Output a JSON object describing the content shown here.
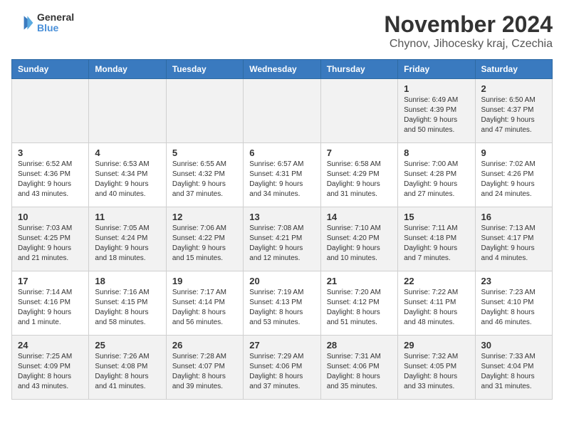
{
  "header": {
    "logo": {
      "line1": "General",
      "line2": "Blue"
    },
    "title": "November 2024",
    "subtitle": "Chynov, Jihocesky kraj, Czechia"
  },
  "weekdays": [
    "Sunday",
    "Monday",
    "Tuesday",
    "Wednesday",
    "Thursday",
    "Friday",
    "Saturday"
  ],
  "weeks": [
    [
      {
        "day": "",
        "info": ""
      },
      {
        "day": "",
        "info": ""
      },
      {
        "day": "",
        "info": ""
      },
      {
        "day": "",
        "info": ""
      },
      {
        "day": "",
        "info": ""
      },
      {
        "day": "1",
        "info": "Sunrise: 6:49 AM\nSunset: 4:39 PM\nDaylight: 9 hours\nand 50 minutes."
      },
      {
        "day": "2",
        "info": "Sunrise: 6:50 AM\nSunset: 4:37 PM\nDaylight: 9 hours\nand 47 minutes."
      }
    ],
    [
      {
        "day": "3",
        "info": "Sunrise: 6:52 AM\nSunset: 4:36 PM\nDaylight: 9 hours\nand 43 minutes."
      },
      {
        "day": "4",
        "info": "Sunrise: 6:53 AM\nSunset: 4:34 PM\nDaylight: 9 hours\nand 40 minutes."
      },
      {
        "day": "5",
        "info": "Sunrise: 6:55 AM\nSunset: 4:32 PM\nDaylight: 9 hours\nand 37 minutes."
      },
      {
        "day": "6",
        "info": "Sunrise: 6:57 AM\nSunset: 4:31 PM\nDaylight: 9 hours\nand 34 minutes."
      },
      {
        "day": "7",
        "info": "Sunrise: 6:58 AM\nSunset: 4:29 PM\nDaylight: 9 hours\nand 31 minutes."
      },
      {
        "day": "8",
        "info": "Sunrise: 7:00 AM\nSunset: 4:28 PM\nDaylight: 9 hours\nand 27 minutes."
      },
      {
        "day": "9",
        "info": "Sunrise: 7:02 AM\nSunset: 4:26 PM\nDaylight: 9 hours\nand 24 minutes."
      }
    ],
    [
      {
        "day": "10",
        "info": "Sunrise: 7:03 AM\nSunset: 4:25 PM\nDaylight: 9 hours\nand 21 minutes."
      },
      {
        "day": "11",
        "info": "Sunrise: 7:05 AM\nSunset: 4:24 PM\nDaylight: 9 hours\nand 18 minutes."
      },
      {
        "day": "12",
        "info": "Sunrise: 7:06 AM\nSunset: 4:22 PM\nDaylight: 9 hours\nand 15 minutes."
      },
      {
        "day": "13",
        "info": "Sunrise: 7:08 AM\nSunset: 4:21 PM\nDaylight: 9 hours\nand 12 minutes."
      },
      {
        "day": "14",
        "info": "Sunrise: 7:10 AM\nSunset: 4:20 PM\nDaylight: 9 hours\nand 10 minutes."
      },
      {
        "day": "15",
        "info": "Sunrise: 7:11 AM\nSunset: 4:18 PM\nDaylight: 9 hours\nand 7 minutes."
      },
      {
        "day": "16",
        "info": "Sunrise: 7:13 AM\nSunset: 4:17 PM\nDaylight: 9 hours\nand 4 minutes."
      }
    ],
    [
      {
        "day": "17",
        "info": "Sunrise: 7:14 AM\nSunset: 4:16 PM\nDaylight: 9 hours\nand 1 minute."
      },
      {
        "day": "18",
        "info": "Sunrise: 7:16 AM\nSunset: 4:15 PM\nDaylight: 8 hours\nand 58 minutes."
      },
      {
        "day": "19",
        "info": "Sunrise: 7:17 AM\nSunset: 4:14 PM\nDaylight: 8 hours\nand 56 minutes."
      },
      {
        "day": "20",
        "info": "Sunrise: 7:19 AM\nSunset: 4:13 PM\nDaylight: 8 hours\nand 53 minutes."
      },
      {
        "day": "21",
        "info": "Sunrise: 7:20 AM\nSunset: 4:12 PM\nDaylight: 8 hours\nand 51 minutes."
      },
      {
        "day": "22",
        "info": "Sunrise: 7:22 AM\nSunset: 4:11 PM\nDaylight: 8 hours\nand 48 minutes."
      },
      {
        "day": "23",
        "info": "Sunrise: 7:23 AM\nSunset: 4:10 PM\nDaylight: 8 hours\nand 46 minutes."
      }
    ],
    [
      {
        "day": "24",
        "info": "Sunrise: 7:25 AM\nSunset: 4:09 PM\nDaylight: 8 hours\nand 43 minutes."
      },
      {
        "day": "25",
        "info": "Sunrise: 7:26 AM\nSunset: 4:08 PM\nDaylight: 8 hours\nand 41 minutes."
      },
      {
        "day": "26",
        "info": "Sunrise: 7:28 AM\nSunset: 4:07 PM\nDaylight: 8 hours\nand 39 minutes."
      },
      {
        "day": "27",
        "info": "Sunrise: 7:29 AM\nSunset: 4:06 PM\nDaylight: 8 hours\nand 37 minutes."
      },
      {
        "day": "28",
        "info": "Sunrise: 7:31 AM\nSunset: 4:06 PM\nDaylight: 8 hours\nand 35 minutes."
      },
      {
        "day": "29",
        "info": "Sunrise: 7:32 AM\nSunset: 4:05 PM\nDaylight: 8 hours\nand 33 minutes."
      },
      {
        "day": "30",
        "info": "Sunrise: 7:33 AM\nSunset: 4:04 PM\nDaylight: 8 hours\nand 31 minutes."
      }
    ]
  ]
}
